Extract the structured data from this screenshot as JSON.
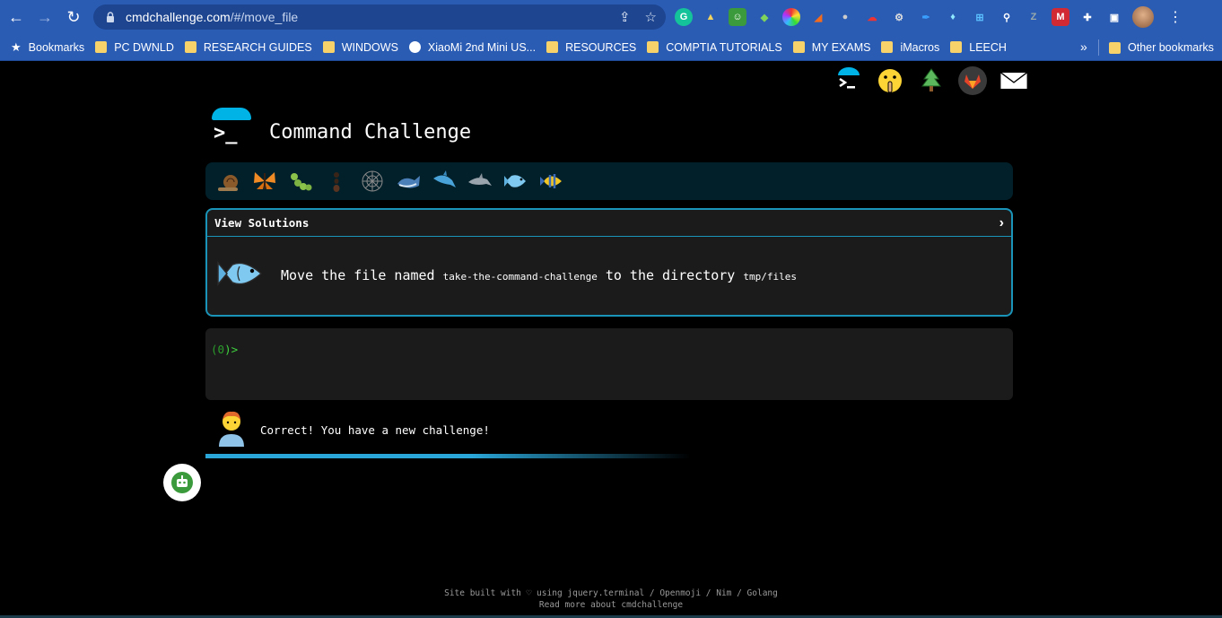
{
  "browser": {
    "url_host": "cmdchallenge.com",
    "url_path": "/#/move_file",
    "bookmarks": [
      {
        "label": "Bookmarks",
        "icon": "star-icon"
      },
      {
        "label": "PC DWNLD",
        "icon": "folder-icon"
      },
      {
        "label": "RESEARCH GUIDES",
        "icon": "folder-icon"
      },
      {
        "label": "WINDOWS",
        "icon": "folder-icon"
      },
      {
        "label": "XiaoMi 2nd Mini US...",
        "icon": "globe-icon"
      },
      {
        "label": "RESOURCES",
        "icon": "folder-icon"
      },
      {
        "label": "COMPTIA TUTORIALS",
        "icon": "folder-icon"
      },
      {
        "label": "MY EXAMS",
        "icon": "folder-icon"
      },
      {
        "label": "iMacros",
        "icon": "folder-icon"
      },
      {
        "label": "LEECH",
        "icon": "folder-icon"
      }
    ],
    "other_bookmarks": "Other bookmarks",
    "more_glyph": "»"
  },
  "page": {
    "title": "Command Challenge",
    "challenge": {
      "header": "View Solutions",
      "text_prefix": "Move the file named ",
      "filename": "take-the-command-challenge",
      "text_middle": " to the directory ",
      "directory": "tmp/files"
    },
    "terminal": {
      "prompt_open": "(",
      "prompt_count": "0",
      "prompt_close": ")>"
    },
    "feedback": "Correct! You have a new challenge!",
    "progress_fraction": 0.6,
    "footer_line1": "Site built with ♡ using jquery.terminal / Openmoji / Nim / Golang",
    "footer_line2": "Read more about cmdchallenge"
  },
  "colors": {
    "background": "#000000",
    "chrome": "#2b5cb4",
    "accent": "#1a94b8",
    "prompt_green": "#3fd53f"
  }
}
